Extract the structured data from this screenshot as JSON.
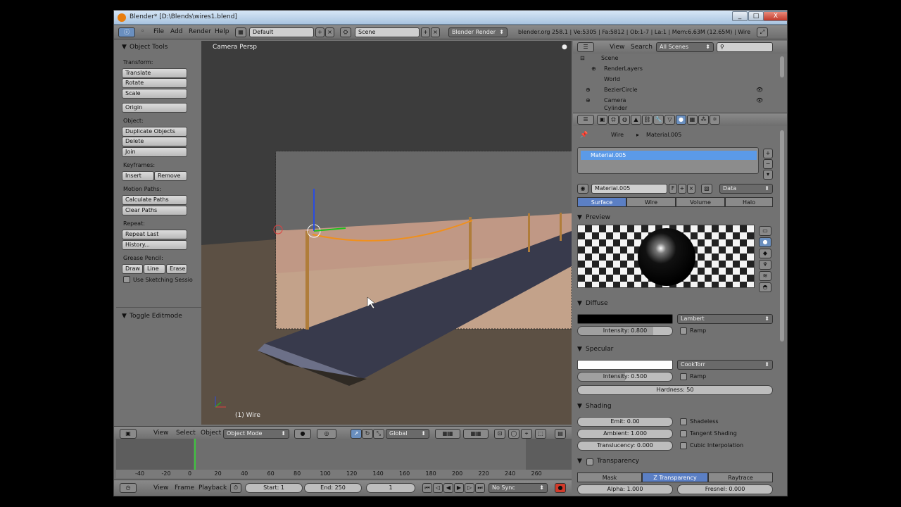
{
  "window": {
    "title": "Blender* [D:\\Blends\\wires1.blend]",
    "controls": {
      "minimize": "_",
      "maximize": "□",
      "close": "X"
    }
  },
  "infobar": {
    "menus": [
      "File",
      "Add",
      "Render",
      "Help"
    ],
    "screen_layout": "Default",
    "scene": "Scene",
    "render_engine": "Blender Render",
    "stats": "blender.org 258.1 | Ve:5305 | Fa:5812 | Ob:1-7 | La:1 | Mem:6.63M (12.65M) | Wire"
  },
  "toolshelf": {
    "panel_title": "Object Tools",
    "transform_label": "Transform:",
    "translate": "Translate",
    "rotate": "Rotate",
    "scale": "Scale",
    "origin": "Origin",
    "object_label": "Object:",
    "duplicate": "Duplicate Objects",
    "delete": "Delete",
    "join": "Join",
    "keyframes_label": "Keyframes:",
    "insert": "Insert",
    "remove": "Remove",
    "motion_paths_label": "Motion Paths:",
    "calc_paths": "Calculate Paths",
    "clear_paths": "Clear Paths",
    "repeat_label": "Repeat:",
    "repeat_last": "Repeat Last",
    "history": "History...",
    "grease_label": "Grease Pencil:",
    "draw": "Draw",
    "line": "Line",
    "erase": "Erase",
    "sketching": "Use Sketching Sessio",
    "toggle_editmode": "Toggle Editmode"
  },
  "viewport": {
    "view_name": "Camera Persp",
    "object_label": "(1) Wire",
    "header": {
      "view": "View",
      "select": "Select",
      "object": "Object",
      "mode": "Object Mode",
      "orientation": "Global"
    }
  },
  "timeline": {
    "ticks": [
      "-40",
      "-20",
      "0",
      "20",
      "40",
      "60",
      "80",
      "100",
      "120",
      "140",
      "160",
      "180",
      "200",
      "220",
      "240",
      "260"
    ],
    "footer": {
      "view": "View",
      "frame": "Frame",
      "playback": "Playback",
      "start": "Start: 1",
      "end": "End: 250",
      "current": "1",
      "sync": "No Sync"
    }
  },
  "outliner": {
    "view": "View",
    "search": "Search",
    "filter": "All Scenes",
    "rows": [
      "Scene",
      "RenderLayers",
      "World",
      "BezierCircle",
      "Camera",
      "Cylinder"
    ]
  },
  "properties": {
    "breadcrumb_object": "Wire",
    "breadcrumb_material": "Material.005",
    "slot_name": "Material.005",
    "material_name": "Material.005",
    "fake_user": "F",
    "link": "Data",
    "tabs": [
      "Surface",
      "Wire",
      "Volume",
      "Halo"
    ],
    "preview_title": "Preview",
    "diffuse": {
      "title": "Diffuse",
      "shader": "Lambert",
      "intensity": "Intensity: 0.800",
      "ramp": "Ramp",
      "color": "#000000"
    },
    "specular": {
      "title": "Specular",
      "shader": "CookTorr",
      "intensity": "Intensity: 0.500",
      "ramp": "Ramp",
      "hardness": "Hardness: 50",
      "color": "#ffffff"
    },
    "shading": {
      "title": "Shading",
      "emit": "Emit: 0.00",
      "ambient": "Ambient: 1.000",
      "translucency": "Translucency: 0.000",
      "shadeless": "Shadeless",
      "tangent": "Tangent Shading",
      "cubic": "Cubic Interpolation"
    },
    "transparency": {
      "title": "Transparency",
      "modes": [
        "Mask",
        "Z Transparency",
        "Raytrace"
      ],
      "alpha": "Alpha: 1.000",
      "fresnel": "Fresnel: 0.000"
    }
  }
}
